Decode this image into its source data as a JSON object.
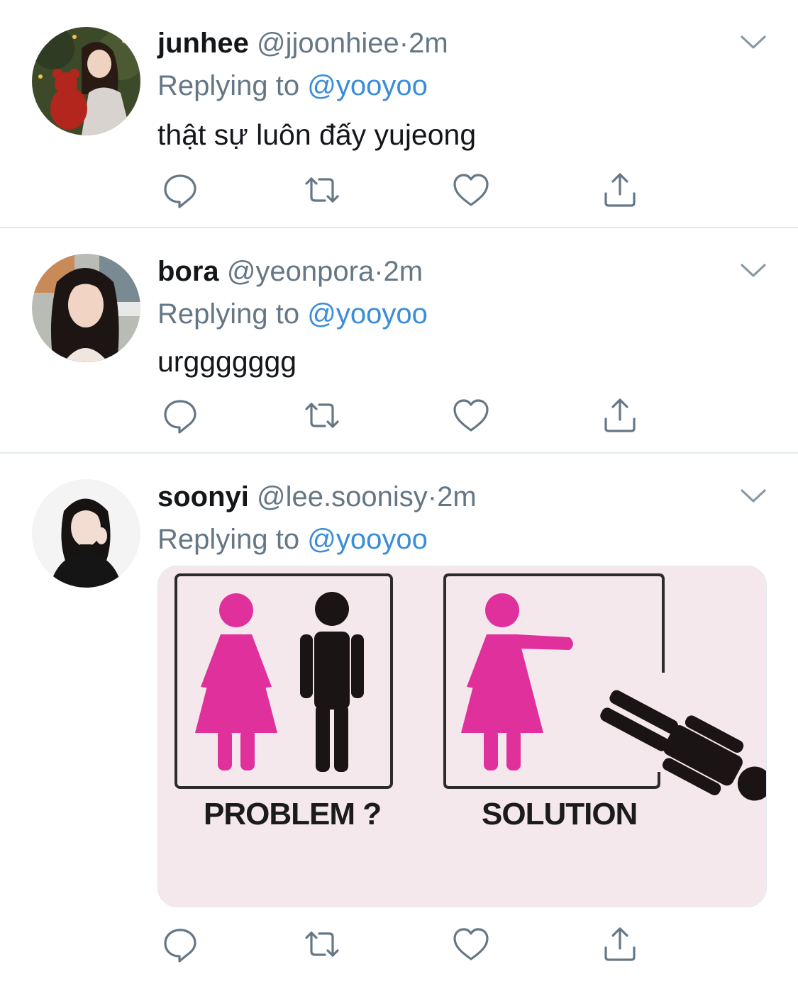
{
  "tweets": [
    {
      "name": "junhee",
      "handle": "@jjoonhiee",
      "dot": "·",
      "time": "2m",
      "replying_prefix": "Replying to",
      "replying_to": "@yooyoo",
      "text": "thật sự luôn đấy yujeong"
    },
    {
      "name": "bora",
      "handle": "@yeonpora",
      "dot": "·",
      "time": "2m",
      "replying_prefix": "Replying to",
      "replying_to": "@yooyoo",
      "text": "urggggggg"
    },
    {
      "name": "soonyi",
      "handle": "@lee.soonisy",
      "dot": "·",
      "time": "2m",
      "replying_prefix": "Replying to",
      "replying_to": "@yooyoo",
      "media": {
        "left_label": "PROBLEM ?",
        "right_label": "SOLUTION"
      }
    }
  ],
  "icons": {
    "reply": "reply-icon",
    "retweet": "retweet-icon",
    "like": "heart-icon",
    "share": "share-icon",
    "menu": "chevron-down-icon"
  },
  "colors": {
    "text": "#14171a",
    "secondary": "#657786",
    "mention": "#3a8ddb",
    "divider": "#e1e8ed",
    "female_figure": "#e0309c",
    "male_figure": "#1a1414"
  }
}
